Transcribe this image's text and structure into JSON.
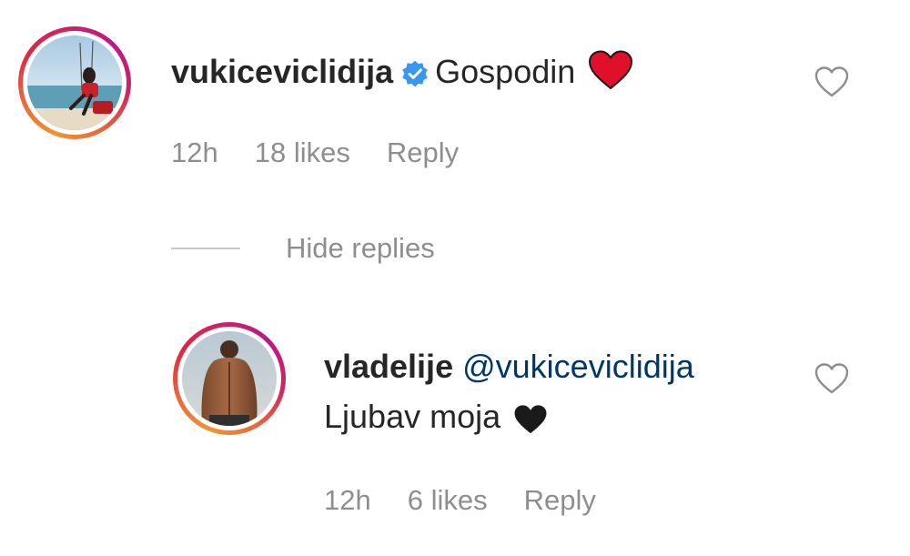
{
  "comment": {
    "username": "vukiceviclidija",
    "verified": true,
    "text": "Gospodin",
    "emoji_icon": "red-heart-icon",
    "time": "12h",
    "likes": "18 likes",
    "reply_label": "Reply"
  },
  "replies_toggle": {
    "label": "Hide replies"
  },
  "reply": {
    "username": "vladelije",
    "mention": "@vukiceviclidija",
    "text": "Ljubav moja",
    "emoji_icon": "black-heart-icon",
    "time": "12h",
    "likes": "6 likes",
    "reply_label": "Reply"
  },
  "colors": {
    "verified_blue": "#3897f0",
    "heart_red": "#e0102a",
    "mention_blue": "#00376b",
    "meta_gray": "#8e8e8e"
  }
}
